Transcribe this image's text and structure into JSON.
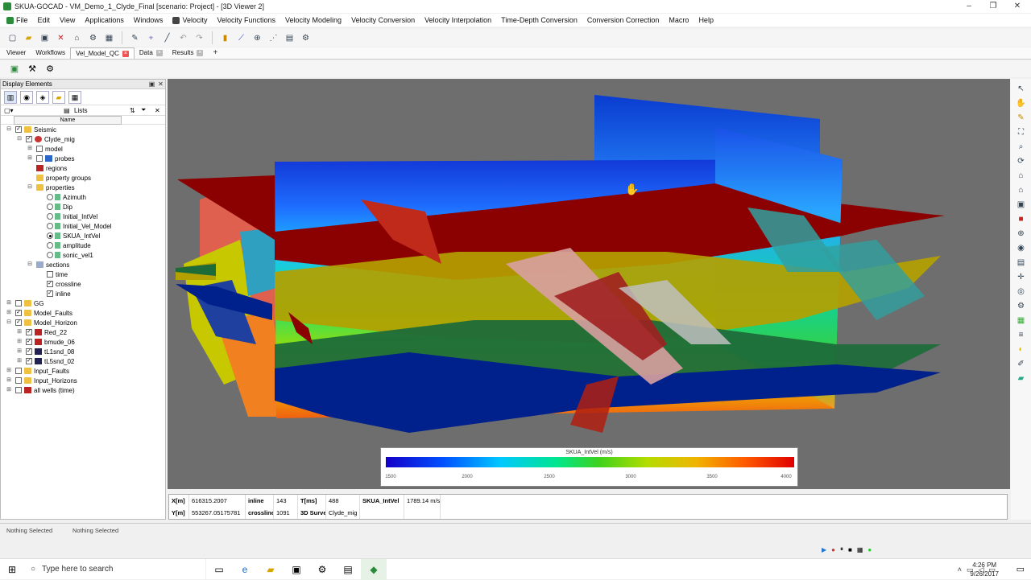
{
  "window": {
    "title": "SKUA-GOCAD - VM_Demo_1_Clyde_Final  [scenario: Project] - [3D Viewer 2]",
    "controls": [
      "–",
      "❐",
      "✕"
    ]
  },
  "menu": [
    "File",
    "Edit",
    "View",
    "Applications",
    "Windows",
    "Velocity",
    "Velocity Functions",
    "Velocity Modeling",
    "Velocity Conversion",
    "Velocity Interpolation",
    "Time-Depth Conversion",
    "Conversion Correction",
    "Macro",
    "Help"
  ],
  "tabs": {
    "items": [
      {
        "label": "Viewer"
      },
      {
        "label": "Workflows"
      },
      {
        "label": "Vel_Model_QC"
      },
      {
        "label": "Data"
      },
      {
        "label": "Results"
      }
    ],
    "add": "+"
  },
  "left_panel": {
    "title": "Display Elements",
    "lists_label": "Lists",
    "column_name": "Name",
    "tree": [
      {
        "label": "Seismic",
        "depth": 0,
        "exp": "−",
        "check": "checked",
        "icon": "folder"
      },
      {
        "label": "Clyde_mig",
        "depth": 1,
        "exp": "−",
        "check": "checked",
        "icon": "gear"
      },
      {
        "label": "model",
        "depth": 2,
        "exp": "+",
        "check": "off",
        "icon": ""
      },
      {
        "label": "probes",
        "depth": 2,
        "exp": "+",
        "check": "off",
        "icon": "cube"
      },
      {
        "label": "regions",
        "depth": 2,
        "exp": "",
        "check": "",
        "icon": "red"
      },
      {
        "label": "property groups",
        "depth": 2,
        "exp": "",
        "check": "",
        "icon": "folder"
      },
      {
        "label": "properties",
        "depth": 2,
        "exp": "−",
        "check": "",
        "icon": "folder"
      },
      {
        "label": "Azimuth",
        "depth": 3,
        "exp": "",
        "check": "radio",
        "icon": "prop"
      },
      {
        "label": "Dip",
        "depth": 3,
        "exp": "",
        "check": "radio",
        "icon": "prop"
      },
      {
        "label": "Initial_IntVel",
        "depth": 3,
        "exp": "",
        "check": "radio",
        "icon": "prop"
      },
      {
        "label": "Initial_Vel_Model",
        "depth": 3,
        "exp": "",
        "check": "radio",
        "icon": "prop"
      },
      {
        "label": "SKUA_IntVel",
        "depth": 3,
        "exp": "",
        "check": "radio-on",
        "icon": "prop"
      },
      {
        "label": "amplitude",
        "depth": 3,
        "exp": "",
        "check": "radio",
        "icon": "prop"
      },
      {
        "label": "sonic_vel1",
        "depth": 3,
        "exp": "",
        "check": "radio",
        "icon": "prop"
      },
      {
        "label": "sections",
        "depth": 2,
        "exp": "−",
        "check": "",
        "icon": "grid"
      },
      {
        "label": "time",
        "depth": 3,
        "exp": "",
        "check": "off",
        "icon": ""
      },
      {
        "label": "crossline",
        "depth": 3,
        "exp": "",
        "check": "checked",
        "icon": ""
      },
      {
        "label": "inline",
        "depth": 3,
        "exp": "",
        "check": "checked",
        "icon": ""
      },
      {
        "label": "GG",
        "depth": 0,
        "exp": "+",
        "check": "off",
        "icon": "folder"
      },
      {
        "label": "Model_Faults",
        "depth": 0,
        "exp": "+",
        "check": "checked",
        "icon": "folder"
      },
      {
        "label": "Model_Horizon",
        "depth": 0,
        "exp": "−",
        "check": "checked",
        "icon": "folder"
      },
      {
        "label": "Red_22",
        "depth": 1,
        "exp": "+",
        "check": "checked",
        "icon": "red"
      },
      {
        "label": "bmude_06",
        "depth": 1,
        "exp": "+",
        "check": "checked",
        "icon": "red"
      },
      {
        "label": "tL1snd_08",
        "depth": 1,
        "exp": "+",
        "check": "checked",
        "icon": "blue"
      },
      {
        "label": "tL5snd_02",
        "depth": 1,
        "exp": "+",
        "check": "checked",
        "icon": "blue"
      },
      {
        "label": "Input_Faults",
        "depth": 0,
        "exp": "+",
        "check": "off",
        "icon": "folder"
      },
      {
        "label": "Input_Horizons",
        "depth": 0,
        "exp": "+",
        "check": "off",
        "icon": "folder"
      },
      {
        "label": "all wells (time)",
        "depth": 0,
        "exp": "+",
        "check": "off",
        "icon": "red"
      }
    ]
  },
  "colorbar": {
    "title": "SKUA_IntVel (m/s)",
    "ticks": [
      "1500",
      "2000",
      "2500",
      "3000",
      "3500",
      "4000"
    ]
  },
  "infobar": {
    "row1": [
      {
        "text": "X[m]",
        "bold": true
      },
      {
        "text": "616315.2007",
        "bold": false
      },
      {
        "text": "inline",
        "bold": true
      },
      {
        "text": "143",
        "bold": false
      },
      {
        "text": "T[ms]",
        "bold": true
      },
      {
        "text": "488",
        "bold": false
      },
      {
        "text": "SKUA_IntVel",
        "bold": true
      },
      {
        "text": "1789.14 m/s",
        "bold": false
      }
    ],
    "row2": [
      {
        "text": "Y[m]",
        "bold": true
      },
      {
        "text": "553267.05175781",
        "bold": false
      },
      {
        "text": "crossline",
        "bold": true
      },
      {
        "text": "1091",
        "bold": false
      },
      {
        "text": "3D Survey",
        "bold": true
      },
      {
        "text": "Clyde_mig",
        "bold": false
      },
      {
        "text": "",
        "bold": false
      },
      {
        "text": "",
        "bold": false
      }
    ]
  },
  "status": {
    "left": "Nothing Selected",
    "right": "Nothing Selected"
  },
  "taskbar": {
    "search_placeholder": "Type here to search",
    "time": "4:26 PM",
    "date": "9/26/2017"
  },
  "colors": {
    "viewport_bg": "#6e6e6e",
    "horizon_red": "#8b0000",
    "horizon_yellow": "#b4a000",
    "horizon_green": "#1e6b3a",
    "horizon_blue": "#00208c"
  }
}
